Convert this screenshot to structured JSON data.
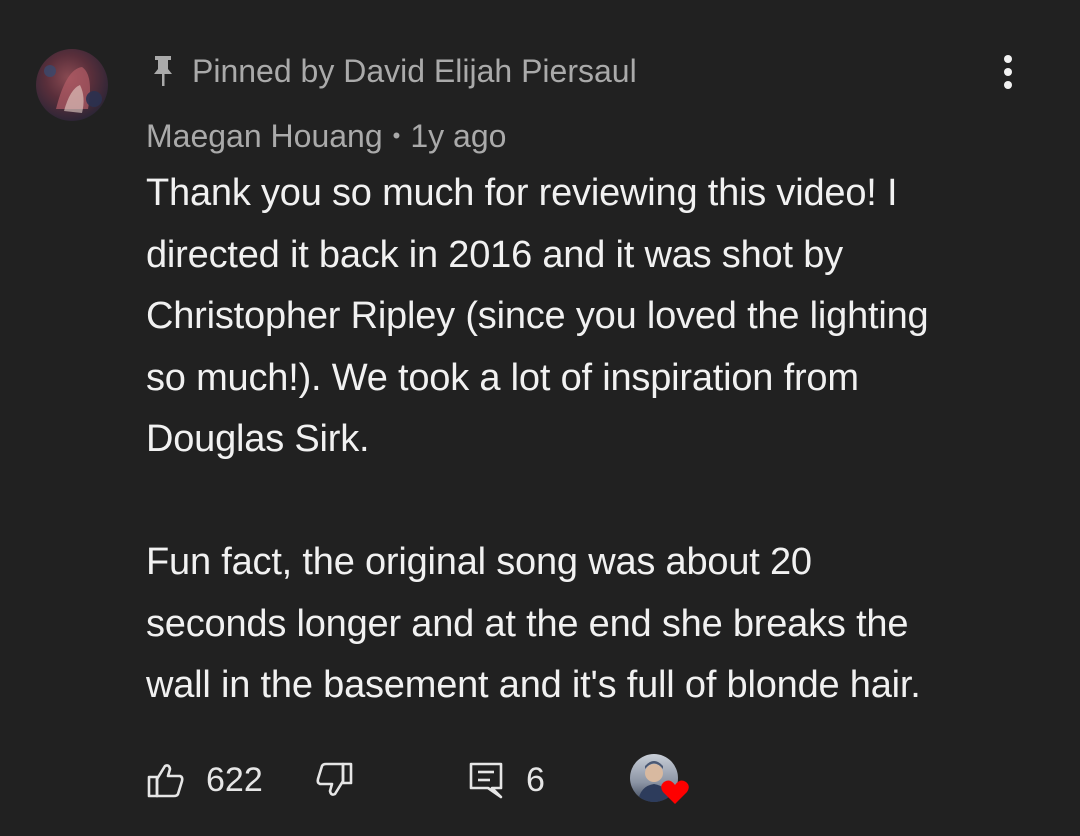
{
  "comment": {
    "pinned_label": "Pinned by David Elijah Piersaul",
    "author": "Maegan Houang",
    "separator": "•",
    "timestamp": "1y ago",
    "body_lines": [
      "Thank you so much for reviewing this video! I",
      "directed it back in 2016 and it was shot by",
      "Christopher Ripley (since you loved the lighting",
      "so much!). We took a lot of inspiration from",
      "Douglas Sirk.",
      "Fun fact, the original song was about 20",
      "seconds longer and at the end she breaks the",
      "wall in the basement and it's full of blonde hair."
    ],
    "actions": {
      "like_count": "622",
      "reply_count": "6"
    }
  },
  "icons": {
    "pin": "pin-icon",
    "more": "more-vert-icon",
    "like": "thumbs-up-icon",
    "dislike": "thumbs-down-icon",
    "reply": "reply-comment-icon",
    "heart": "heart-icon"
  },
  "colors": {
    "background": "#212121",
    "meta_text": "#aaaaaa",
    "body_text": "#f1f1f1",
    "heart": "#ff0000"
  }
}
